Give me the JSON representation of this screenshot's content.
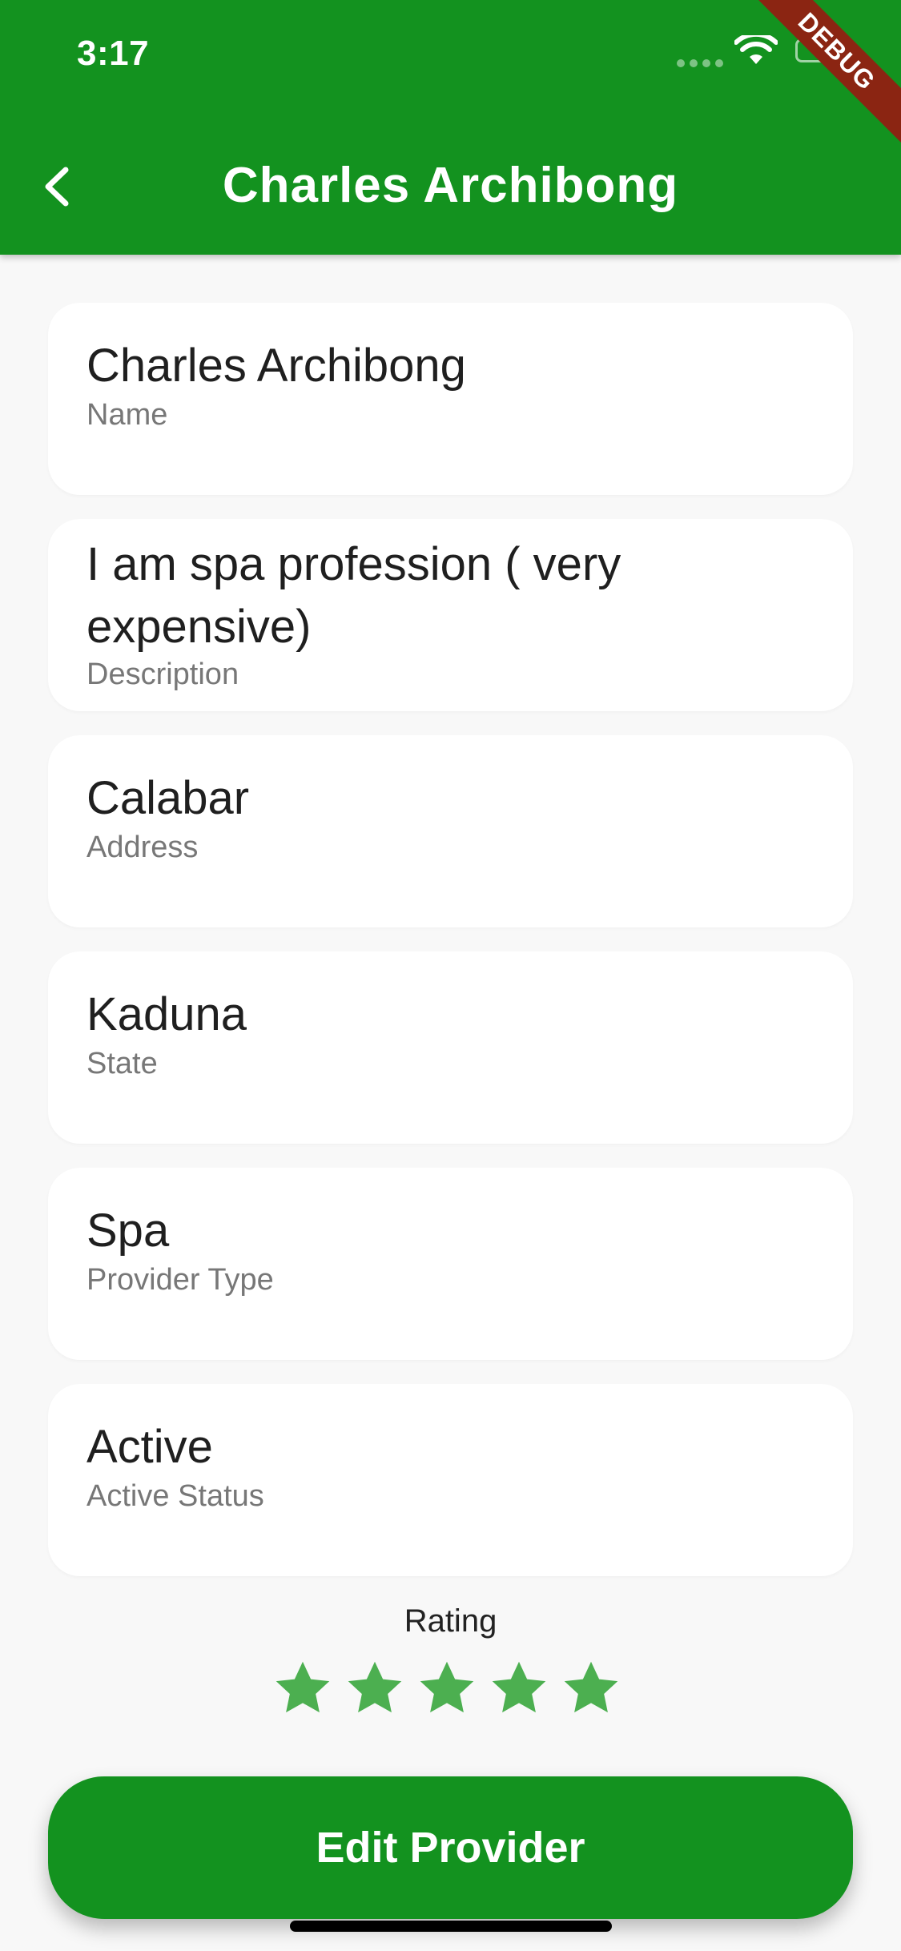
{
  "status_bar": {
    "time": "3:17"
  },
  "debug_banner": "DEBUG",
  "header": {
    "title": "Charles Archibong",
    "back_icon": "chevron-left-icon"
  },
  "fields": [
    {
      "value": "Charles Archibong",
      "label": "Name"
    },
    {
      "value": "I am spa profession ( very expensive)",
      "label": "Description"
    },
    {
      "value": "Calabar",
      "label": "Address"
    },
    {
      "value": "Kaduna",
      "label": "State"
    },
    {
      "value": "Spa",
      "label": "Provider Type"
    },
    {
      "value": "Active",
      "label": "Active Status"
    }
  ],
  "rating": {
    "label": "Rating",
    "value": 5,
    "max": 5,
    "star_color": "#4caf50"
  },
  "actions": {
    "edit_label": "Edit Provider"
  },
  "colors": {
    "primary": "#13921f",
    "background": "#f8f8f8",
    "card": "#ffffff"
  }
}
